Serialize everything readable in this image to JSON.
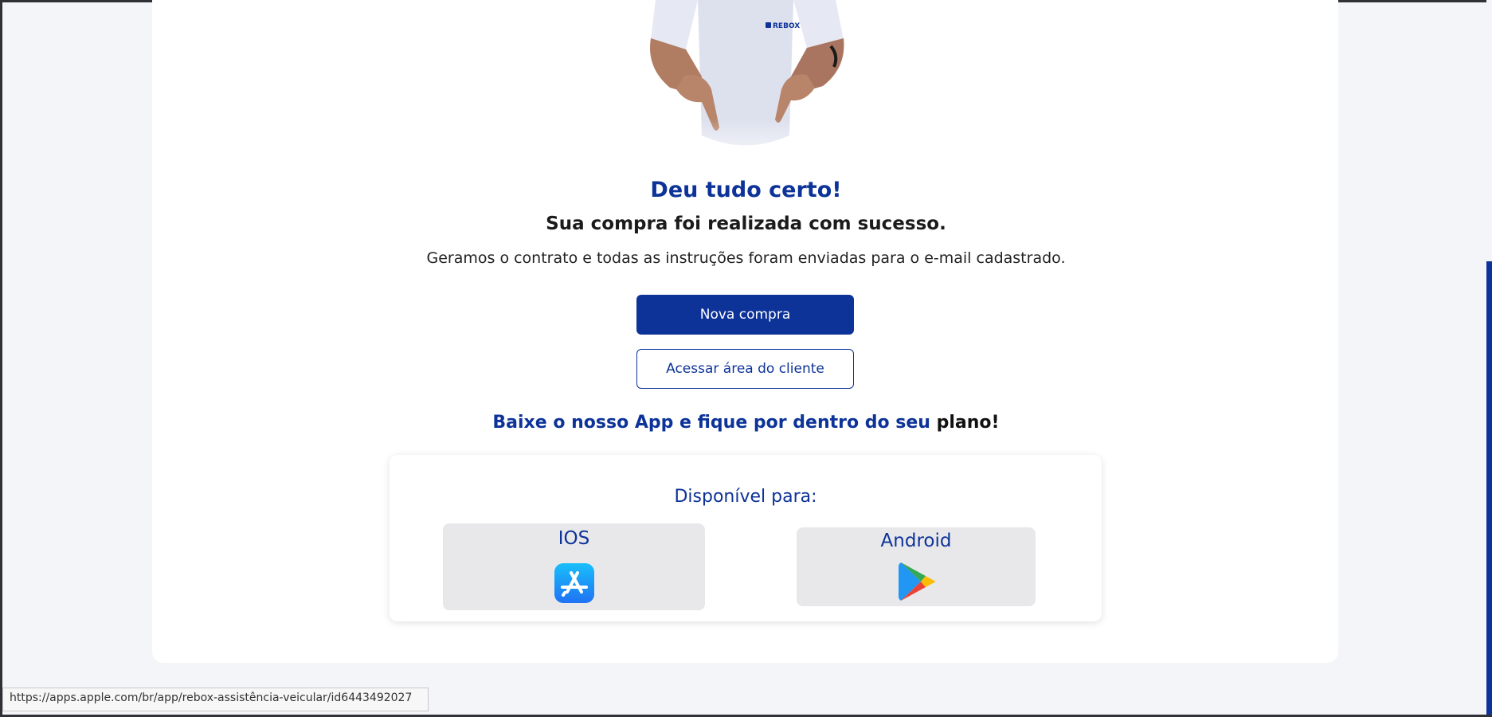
{
  "hero": {
    "shirt_logo_text": "REBOX",
    "icon": "person-pointing-down-image"
  },
  "confirmation": {
    "title": "Deu tudo certo!",
    "subtitle": "Sua compra foi realizada com sucesso.",
    "description": "Geramos o contrato e todas as instruções foram enviadas para o e-mail cadastrado."
  },
  "actions": {
    "new_purchase_label": "Nova compra",
    "client_area_label": "Acessar área do cliente"
  },
  "app_promo": {
    "heading_main": "Baixe o nosso App e fique por dentro do seu",
    "heading_tail": "plano!",
    "available_label": "Disponível para:",
    "stores": [
      {
        "label": "IOS",
        "icon": "app-store-icon"
      },
      {
        "label": "Android",
        "icon": "google-play-icon"
      }
    ]
  },
  "status_bar": {
    "url": "https://apps.apple.com/br/app/rebox-assistência-veicular/id6443492027"
  },
  "colors": {
    "brand_blue": "#0d3399",
    "page_background": "#f4f5f9",
    "store_card_background": "#e8e8ea"
  }
}
